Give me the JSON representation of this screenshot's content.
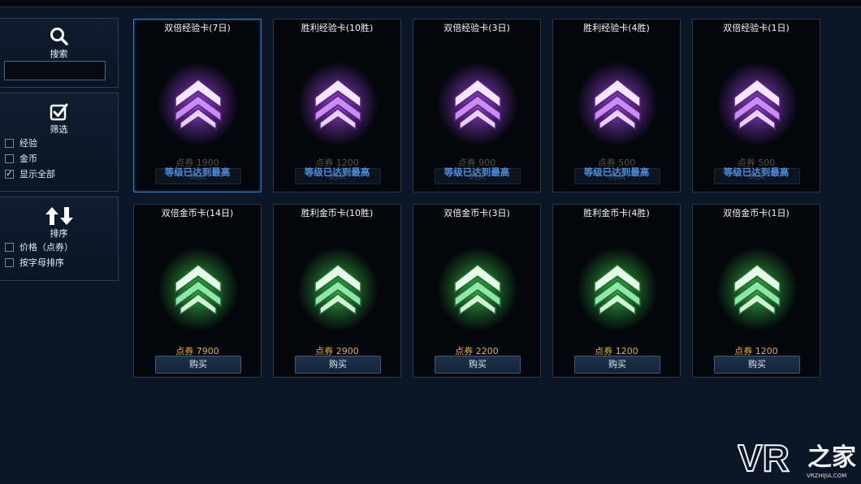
{
  "sidebar": {
    "search": {
      "label": "搜索",
      "value": ""
    },
    "filter": {
      "label": "筛选",
      "options": [
        {
          "label": "经验",
          "checked": false
        },
        {
          "label": "金币",
          "checked": false
        },
        {
          "label": "显示全部",
          "checked": true
        }
      ]
    },
    "sort": {
      "label": "排序",
      "options": [
        {
          "label": "价格（点券）",
          "checked": false
        },
        {
          "label": "按字母排序",
          "checked": false
        }
      ]
    }
  },
  "cards": [
    {
      "title": "双倍经验卡(7日)",
      "type": "xp",
      "price": "点券 1900",
      "button": "购买",
      "note": "等级已达到最高",
      "selected": true
    },
    {
      "title": "胜利经验卡(10胜)",
      "type": "xp",
      "price": "点券 1200",
      "button": "购买",
      "note": "等级已达到最高",
      "selected": false
    },
    {
      "title": "双倍经验卡(3日)",
      "type": "xp",
      "price": "点券 900",
      "button": "购买",
      "note": "等级已达到最高",
      "selected": false
    },
    {
      "title": "胜利经验卡(4胜)",
      "type": "xp",
      "price": "点券 500",
      "button": "购买",
      "note": "等级已达到最高",
      "selected": false
    },
    {
      "title": "双倍经验卡(1日)",
      "type": "xp",
      "price": "点券 500",
      "button": "购买",
      "note": "等级已达到最高",
      "selected": false
    },
    {
      "title": "双倍金币卡(14日)",
      "type": "gold",
      "price": "点券 7900",
      "button": "购买",
      "note": "",
      "selected": false
    },
    {
      "title": "胜利金币卡(10胜)",
      "type": "gold",
      "price": "点券 2900",
      "button": "购买",
      "note": "",
      "selected": false
    },
    {
      "title": "双倍金币卡(3日)",
      "type": "gold",
      "price": "点券 2200",
      "button": "购买",
      "note": "",
      "selected": false
    },
    {
      "title": "胜利金币卡(4胜)",
      "type": "gold",
      "price": "点券 1200",
      "button": "购买",
      "note": "",
      "selected": false
    },
    {
      "title": "双倍金币卡(1日)",
      "type": "gold",
      "price": "点券 1200",
      "button": "购买",
      "note": "",
      "selected": false
    }
  ],
  "watermark": {
    "main": "VR之家",
    "sub": "VRZHIJIA.COM"
  },
  "colors": {
    "xp_glow": "#b24cff",
    "gold_glow": "#3fd24a",
    "price": "#e8b13a",
    "note": "#4a8fe0",
    "selected_border": "#3f7fc8"
  },
  "icons": {
    "search": "magnifier-icon",
    "filter": "checkbox-check-icon",
    "sort": "up-down-arrows-icon",
    "xp_card": "purple-chevron-emblem-icon",
    "gold_card": "green-chevron-emblem-icon"
  }
}
